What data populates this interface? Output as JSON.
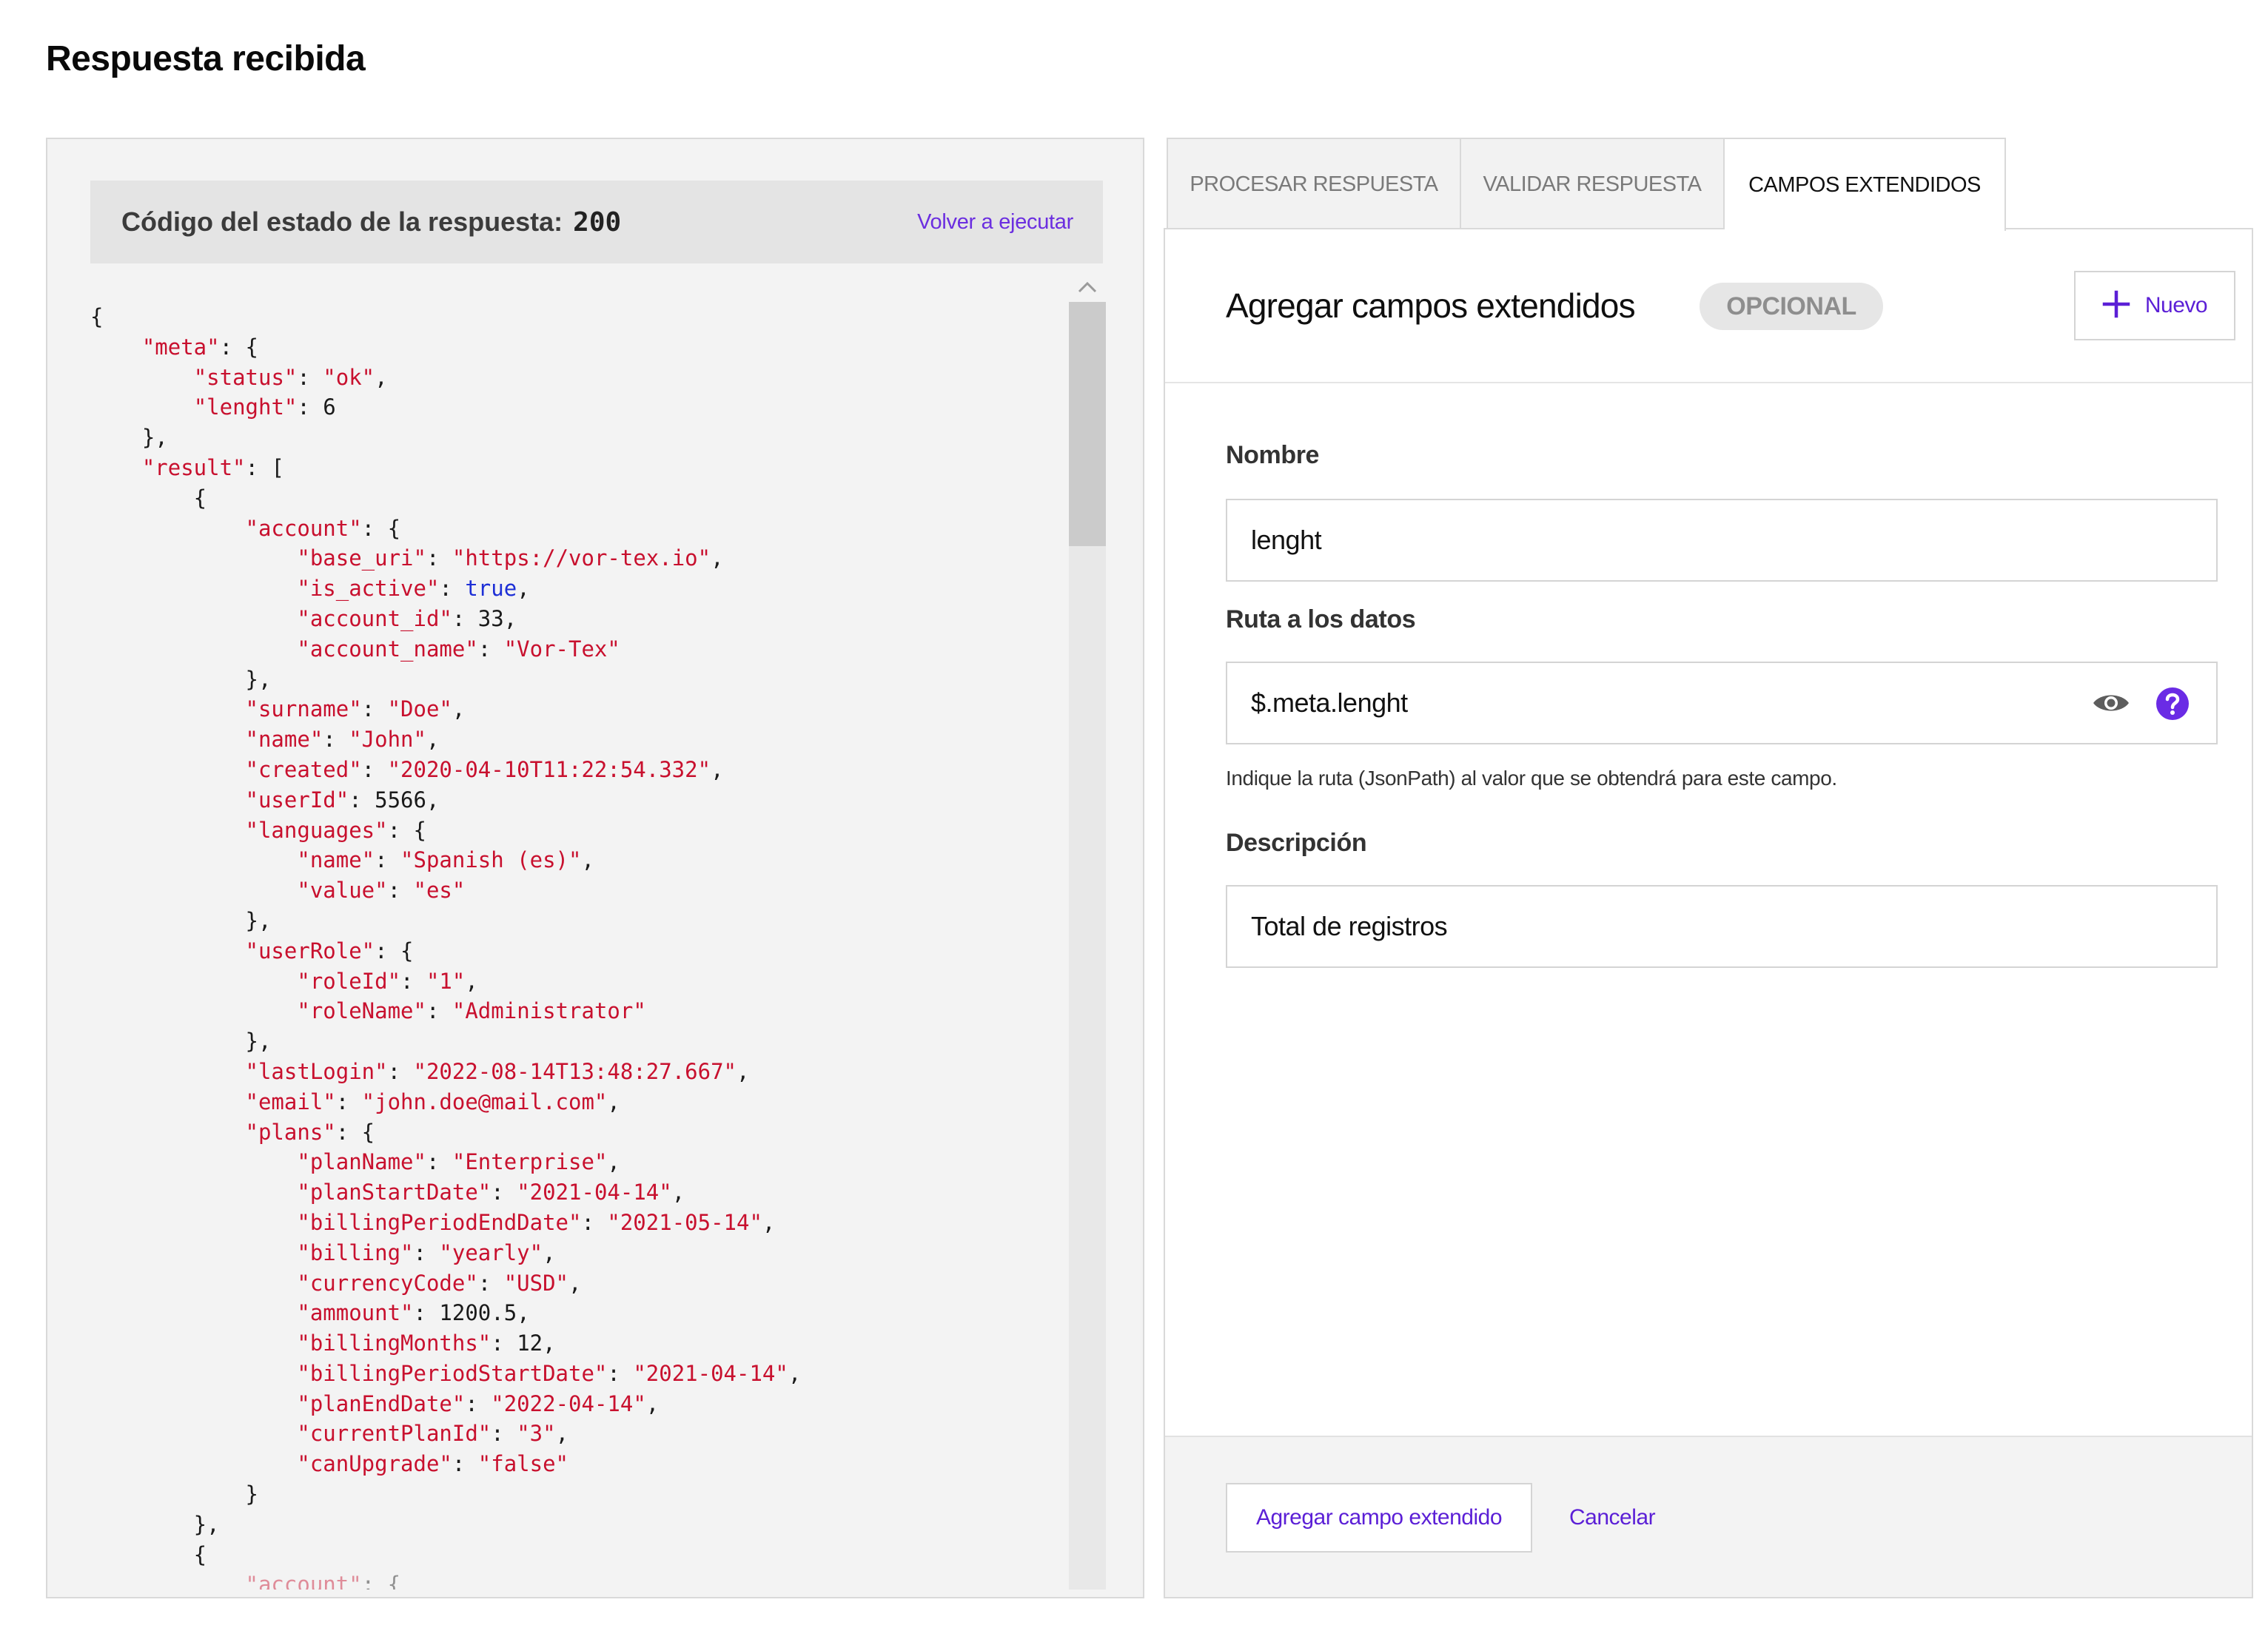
{
  "page": {
    "title": "Respuesta recibida"
  },
  "response": {
    "status_label": "Código del estado de la respuesta:",
    "status_code": "200",
    "rerun_label": "Volver a ejecutar",
    "json_lines": [
      [
        [
          "p",
          "{"
        ]
      ],
      [
        [
          "p",
          "    "
        ],
        [
          "k",
          "\"meta\""
        ],
        [
          "p",
          ": {"
        ]
      ],
      [
        [
          "p",
          "        "
        ],
        [
          "k",
          "\"status\""
        ],
        [
          "p",
          ": "
        ],
        [
          "s",
          "\"ok\""
        ],
        [
          "p",
          ","
        ]
      ],
      [
        [
          "p",
          "        "
        ],
        [
          "k",
          "\"lenght\""
        ],
        [
          "p",
          ": "
        ],
        [
          "n",
          "6"
        ]
      ],
      [
        [
          "p",
          "    },"
        ]
      ],
      [
        [
          "p",
          "    "
        ],
        [
          "k",
          "\"result\""
        ],
        [
          "p",
          ": ["
        ]
      ],
      [
        [
          "p",
          "        {"
        ]
      ],
      [
        [
          "p",
          "            "
        ],
        [
          "k",
          "\"account\""
        ],
        [
          "p",
          ": {"
        ]
      ],
      [
        [
          "p",
          "                "
        ],
        [
          "k",
          "\"base_uri\""
        ],
        [
          "p",
          ": "
        ],
        [
          "s",
          "\"https://vor-tex.io\""
        ],
        [
          "p",
          ","
        ]
      ],
      [
        [
          "p",
          "                "
        ],
        [
          "k",
          "\"is_active\""
        ],
        [
          "p",
          ": "
        ],
        [
          "b",
          "true"
        ],
        [
          "p",
          ","
        ]
      ],
      [
        [
          "p",
          "                "
        ],
        [
          "k",
          "\"account_id\""
        ],
        [
          "p",
          ": "
        ],
        [
          "n",
          "33"
        ],
        [
          "p",
          ","
        ]
      ],
      [
        [
          "p",
          "                "
        ],
        [
          "k",
          "\"account_name\""
        ],
        [
          "p",
          ": "
        ],
        [
          "s",
          "\"Vor-Tex\""
        ]
      ],
      [
        [
          "p",
          "            },"
        ]
      ],
      [
        [
          "p",
          "            "
        ],
        [
          "k",
          "\"surname\""
        ],
        [
          "p",
          ": "
        ],
        [
          "s",
          "\"Doe\""
        ],
        [
          "p",
          ","
        ]
      ],
      [
        [
          "p",
          "            "
        ],
        [
          "k",
          "\"name\""
        ],
        [
          "p",
          ": "
        ],
        [
          "s",
          "\"John\""
        ],
        [
          "p",
          ","
        ]
      ],
      [
        [
          "p",
          "            "
        ],
        [
          "k",
          "\"created\""
        ],
        [
          "p",
          ": "
        ],
        [
          "s",
          "\"2020-04-10T11:22:54.332\""
        ],
        [
          "p",
          ","
        ]
      ],
      [
        [
          "p",
          "            "
        ],
        [
          "k",
          "\"userId\""
        ],
        [
          "p",
          ": "
        ],
        [
          "n",
          "5566"
        ],
        [
          "p",
          ","
        ]
      ],
      [
        [
          "p",
          "            "
        ],
        [
          "k",
          "\"languages\""
        ],
        [
          "p",
          ": {"
        ]
      ],
      [
        [
          "p",
          "                "
        ],
        [
          "k",
          "\"name\""
        ],
        [
          "p",
          ": "
        ],
        [
          "s",
          "\"Spanish (es)\""
        ],
        [
          "p",
          ","
        ]
      ],
      [
        [
          "p",
          "                "
        ],
        [
          "k",
          "\"value\""
        ],
        [
          "p",
          ": "
        ],
        [
          "s",
          "\"es\""
        ]
      ],
      [
        [
          "p",
          "            },"
        ]
      ],
      [
        [
          "p",
          "            "
        ],
        [
          "k",
          "\"userRole\""
        ],
        [
          "p",
          ": {"
        ]
      ],
      [
        [
          "p",
          "                "
        ],
        [
          "k",
          "\"roleId\""
        ],
        [
          "p",
          ": "
        ],
        [
          "s",
          "\"1\""
        ],
        [
          "p",
          ","
        ]
      ],
      [
        [
          "p",
          "                "
        ],
        [
          "k",
          "\"roleName\""
        ],
        [
          "p",
          ": "
        ],
        [
          "s",
          "\"Administrator\""
        ]
      ],
      [
        [
          "p",
          "            },"
        ]
      ],
      [
        [
          "p",
          "            "
        ],
        [
          "k",
          "\"lastLogin\""
        ],
        [
          "p",
          ": "
        ],
        [
          "s",
          "\"2022-08-14T13:48:27.667\""
        ],
        [
          "p",
          ","
        ]
      ],
      [
        [
          "p",
          "            "
        ],
        [
          "k",
          "\"email\""
        ],
        [
          "p",
          ": "
        ],
        [
          "s",
          "\"john.doe@mail.com\""
        ],
        [
          "p",
          ","
        ]
      ],
      [
        [
          "p",
          "            "
        ],
        [
          "k",
          "\"plans\""
        ],
        [
          "p",
          ": {"
        ]
      ],
      [
        [
          "p",
          "                "
        ],
        [
          "k",
          "\"planName\""
        ],
        [
          "p",
          ": "
        ],
        [
          "s",
          "\"Enterprise\""
        ],
        [
          "p",
          ","
        ]
      ],
      [
        [
          "p",
          "                "
        ],
        [
          "k",
          "\"planStartDate\""
        ],
        [
          "p",
          ": "
        ],
        [
          "s",
          "\"2021-04-14\""
        ],
        [
          "p",
          ","
        ]
      ],
      [
        [
          "p",
          "                "
        ],
        [
          "k",
          "\"billingPeriodEndDate\""
        ],
        [
          "p",
          ": "
        ],
        [
          "s",
          "\"2021-05-14\""
        ],
        [
          "p",
          ","
        ]
      ],
      [
        [
          "p",
          "                "
        ],
        [
          "k",
          "\"billing\""
        ],
        [
          "p",
          ": "
        ],
        [
          "s",
          "\"yearly\""
        ],
        [
          "p",
          ","
        ]
      ],
      [
        [
          "p",
          "                "
        ],
        [
          "k",
          "\"currencyCode\""
        ],
        [
          "p",
          ": "
        ],
        [
          "s",
          "\"USD\""
        ],
        [
          "p",
          ","
        ]
      ],
      [
        [
          "p",
          "                "
        ],
        [
          "k",
          "\"ammount\""
        ],
        [
          "p",
          ": "
        ],
        [
          "n",
          "1200.5"
        ],
        [
          "p",
          ","
        ]
      ],
      [
        [
          "p",
          "                "
        ],
        [
          "k",
          "\"billingMonths\""
        ],
        [
          "p",
          ": "
        ],
        [
          "n",
          "12"
        ],
        [
          "p",
          ","
        ]
      ],
      [
        [
          "p",
          "                "
        ],
        [
          "k",
          "\"billingPeriodStartDate\""
        ],
        [
          "p",
          ": "
        ],
        [
          "s",
          "\"2021-04-14\""
        ],
        [
          "p",
          ","
        ]
      ],
      [
        [
          "p",
          "                "
        ],
        [
          "k",
          "\"planEndDate\""
        ],
        [
          "p",
          ": "
        ],
        [
          "s",
          "\"2022-04-14\""
        ],
        [
          "p",
          ","
        ]
      ],
      [
        [
          "p",
          "                "
        ],
        [
          "k",
          "\"currentPlanId\""
        ],
        [
          "p",
          ": "
        ],
        [
          "s",
          "\"3\""
        ],
        [
          "p",
          ","
        ]
      ],
      [
        [
          "p",
          "                "
        ],
        [
          "k",
          "\"canUpgrade\""
        ],
        [
          "p",
          ": "
        ],
        [
          "s",
          "\"false\""
        ]
      ],
      [
        [
          "p",
          "            }"
        ]
      ],
      [
        [
          "p",
          "        },"
        ]
      ],
      [
        [
          "p",
          "        {"
        ]
      ],
      [
        [
          "p",
          "            "
        ],
        [
          "k",
          "\"account\""
        ],
        [
          "p",
          ": {"
        ]
      ]
    ]
  },
  "tabs": [
    {
      "label": "PROCESAR RESPUESTA",
      "active": false
    },
    {
      "label": "VALIDAR RESPUESTA",
      "active": false
    },
    {
      "label": "CAMPOS EXTENDIDOS",
      "active": true
    }
  ],
  "extended_fields": {
    "title": "Agregar campos extendidos",
    "badge": "OPCIONAL",
    "new_button_label": "Nuevo",
    "name_label": "Nombre",
    "name_value": "lenght",
    "path_label": "Ruta a los datos",
    "path_value": "$.meta.lenght",
    "path_helper": "Indique la ruta (JsonPath) al valor que se obtendrá para este campo.",
    "description_label": "Descripción",
    "description_value": "Total de registros",
    "add_button_label": "Agregar campo extendido",
    "cancel_label": "Cancelar"
  },
  "icons": {
    "new": "plus-icon",
    "preview": "eye-icon",
    "help": "help-circle-icon",
    "scroll_up": "chevron-up-icon",
    "scroll_down": "chevron-down-icon"
  },
  "colors": {
    "accent": "#5b1fd6",
    "json_key": "#c8102e",
    "json_boolean": "#1d2fd6"
  }
}
